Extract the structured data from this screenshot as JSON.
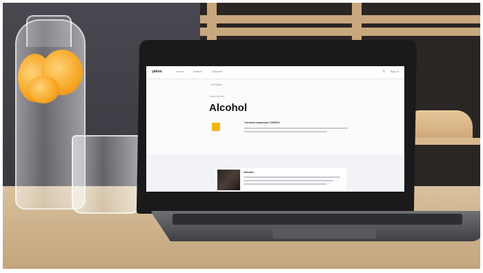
{
  "screen": {
    "nav": {
      "logo": "yahoo",
      "items": [
        "Home",
        "Search",
        "Discover"
      ],
      "signin": "Sign in"
    },
    "breadcrumb": "< All Topics",
    "eyebrow": "About Alcohol",
    "title": "Alcohol",
    "chemical_label": "Chemical compound C2H5OH",
    "card_title": "Alcohol"
  },
  "colors": {
    "swatch": "#f5b50a",
    "search_icon": "#7a6cf0"
  },
  "icons": {
    "search": "search-icon"
  }
}
